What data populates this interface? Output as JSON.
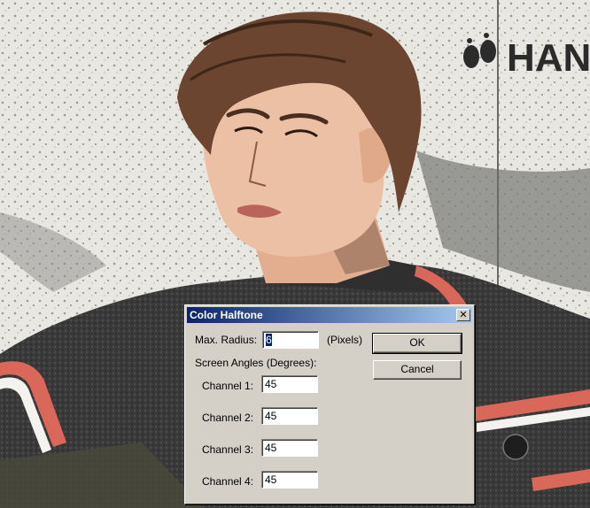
{
  "background": {
    "logo_text": "HAN"
  },
  "dialog": {
    "title": "Color Halftone",
    "close_symbol": "✕",
    "max_radius_label": "Max. Radius:",
    "max_radius_value": "6",
    "max_radius_unit": "(Pixels)",
    "screen_angles_label": "Screen Angles (Degrees):",
    "channels": [
      {
        "label": "Channel 1:",
        "value": "45"
      },
      {
        "label": "Channel 2:",
        "value": "45"
      },
      {
        "label": "Channel 3:",
        "value": "45"
      },
      {
        "label": "Channel 4:",
        "value": "45"
      }
    ],
    "ok_label": "OK",
    "cancel_label": "Cancel"
  },
  "colors": {
    "dialog_face": "#d4d0c8",
    "titlebar_start": "#0a246a",
    "titlebar_end": "#a6caf0",
    "skin": "#e8b89c",
    "hair": "#6b4530",
    "shirt": "#3c3c3c",
    "stripe_red": "#d9675a"
  }
}
